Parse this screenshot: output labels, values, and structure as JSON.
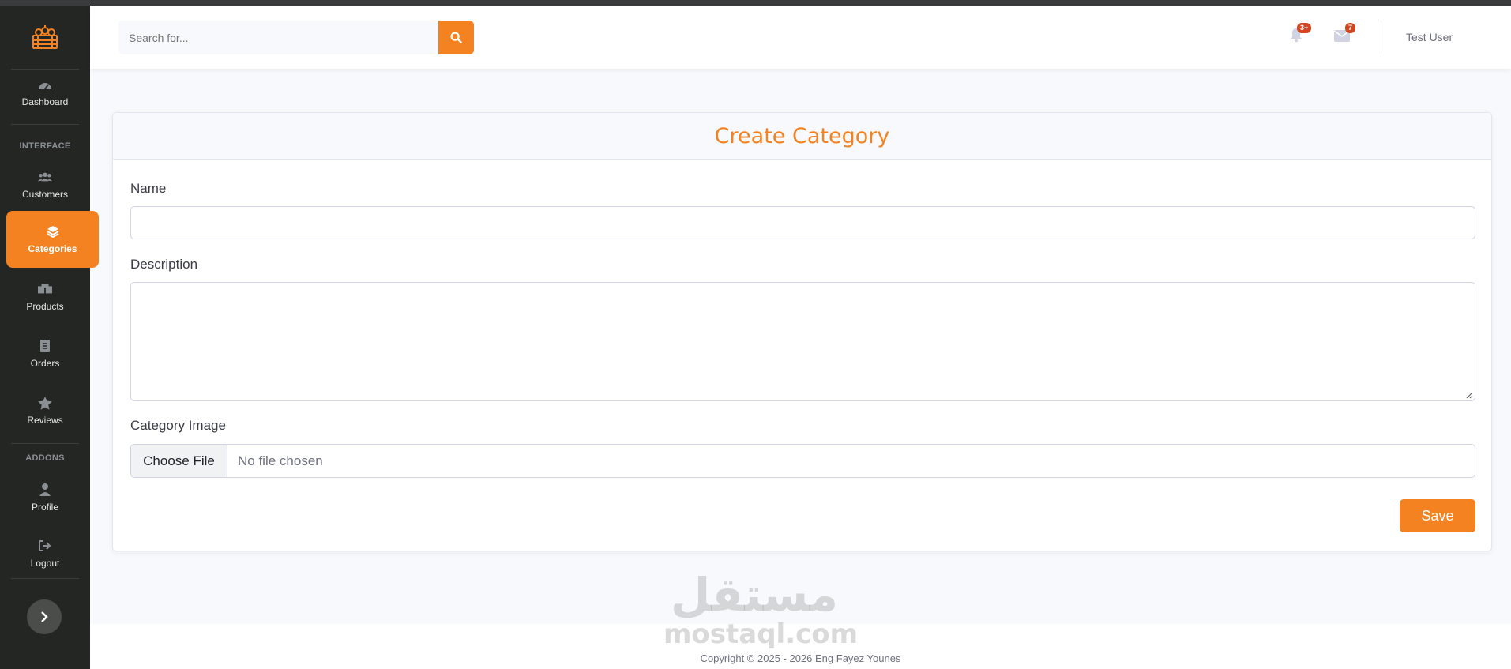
{
  "sidebar": {
    "items": [
      {
        "label": "Dashboard",
        "icon": "dashboard-gauge-icon"
      },
      {
        "label": "Customers",
        "icon": "users-icon"
      },
      {
        "label": "Categories",
        "icon": "layers-icon"
      },
      {
        "label": "Products",
        "icon": "boxes-icon"
      },
      {
        "label": "Orders",
        "icon": "document-icon"
      },
      {
        "label": "Reviews",
        "icon": "star-icon"
      },
      {
        "label": "Profile",
        "icon": "user-icon"
      },
      {
        "label": "Logout",
        "icon": "sign-out-icon"
      }
    ],
    "sections": {
      "interface": "INTERFACE",
      "addons": "ADDONS"
    },
    "active": "Categories"
  },
  "topbar": {
    "search_placeholder": "Search for...",
    "alerts_badge": "3+",
    "messages_badge": "7",
    "user_name": "Test User"
  },
  "form": {
    "title": "Create Category",
    "name_label": "Name",
    "name_value": "",
    "description_label": "Description",
    "description_value": "",
    "image_label": "Category Image",
    "file_button": "Choose File",
    "file_status": "No file chosen",
    "save_label": "Save"
  },
  "footer": {
    "copyright": "Copyright © 2025 - 2026 Eng Fayez Younes"
  },
  "watermark": {
    "arabic": "مستقل",
    "latin": "mostaql.com"
  },
  "colors": {
    "accent": "#f58220",
    "sidebar": "#232623",
    "badge": "#d2461f"
  }
}
